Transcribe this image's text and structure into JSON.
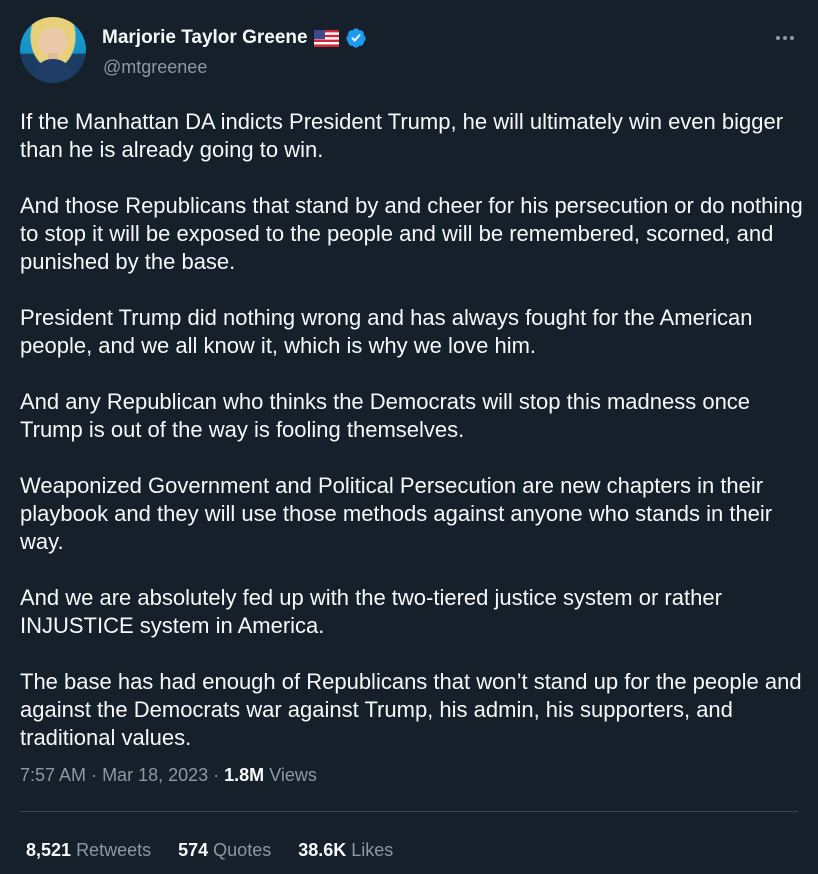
{
  "author": {
    "name": "Marjorie Taylor Greene",
    "handle": "@mtgreenee",
    "flag_icon": "us-flag-icon",
    "verified_icon": "verified-badge-icon"
  },
  "tweet": {
    "text": "If the Manhattan DA indicts President Trump, he will ultimately win even bigger than he is already going to win.\n\nAnd those Republicans that stand by and cheer for his persecution or do nothing to stop it will be exposed to the people and will be remembered, scorned, and punished by the base.\n\nPresident Trump did nothing wrong and has always fought for the American people, and we all know it, which is why we love him.\n\nAnd any Republican who thinks the Democrats will stop this madness once Trump is out of the way is fooling themselves.\n\nWeaponized Government and Political Persecution are new chapters in their playbook and they will use those methods against anyone who stands in their way.\n\nAnd we are absolutely fed up with the two-tiered justice system or rather INJUSTICE system in America.\n\nThe base has had enough of Republicans that won’t stand up for the people and against the Democrats war against Trump, his admin, his supporters, and traditional values.",
    "time": "7:57 AM",
    "date": "Mar 18, 2023",
    "views_count": "1.8M",
    "views_label": "Views"
  },
  "stats": {
    "retweets_count": "8,521",
    "retweets_label": "Retweets",
    "quotes_count": "574",
    "quotes_label": "Quotes",
    "likes_count": "38.6K",
    "likes_label": "Likes"
  },
  "colors": {
    "background": "#15202b",
    "text": "#f7f9f9",
    "muted": "#8b98a5",
    "verified": "#1d9bf0"
  }
}
